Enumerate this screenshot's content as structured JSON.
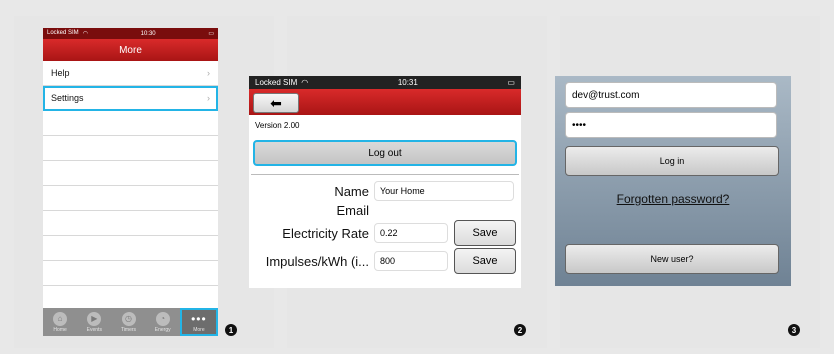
{
  "step_markers": [
    "1",
    "2",
    "3"
  ],
  "screen1": {
    "status": {
      "carrier": "Locked SIM",
      "time": "10:30"
    },
    "title": "More",
    "items": [
      {
        "label": "Help"
      },
      {
        "label": "Settings"
      }
    ],
    "tabs": [
      "Home",
      "Events",
      "Timers",
      "Energy",
      "More"
    ]
  },
  "screen2": {
    "status": {
      "carrier": "Locked SIM",
      "time": "10:31"
    },
    "version": "Version 2.00",
    "logout_label": "Log out",
    "fields": {
      "name_label": "Name",
      "name_value": "Your Home",
      "email_label": "Email",
      "rate_label": "Electricity Rate",
      "rate_value": "0.22",
      "impulses_label": "Impulses/kWh (i...",
      "impulses_value": "800"
    },
    "save_label": "Save"
  },
  "screen3": {
    "email_value": "dev@trust.com",
    "password_value": "••••",
    "login_label": "Log in",
    "forgot_label": "Forgotten password?",
    "new_user_label": "New user?"
  },
  "colors": {
    "accent": "#23b4e6",
    "brand_red": "#c41e1e"
  }
}
